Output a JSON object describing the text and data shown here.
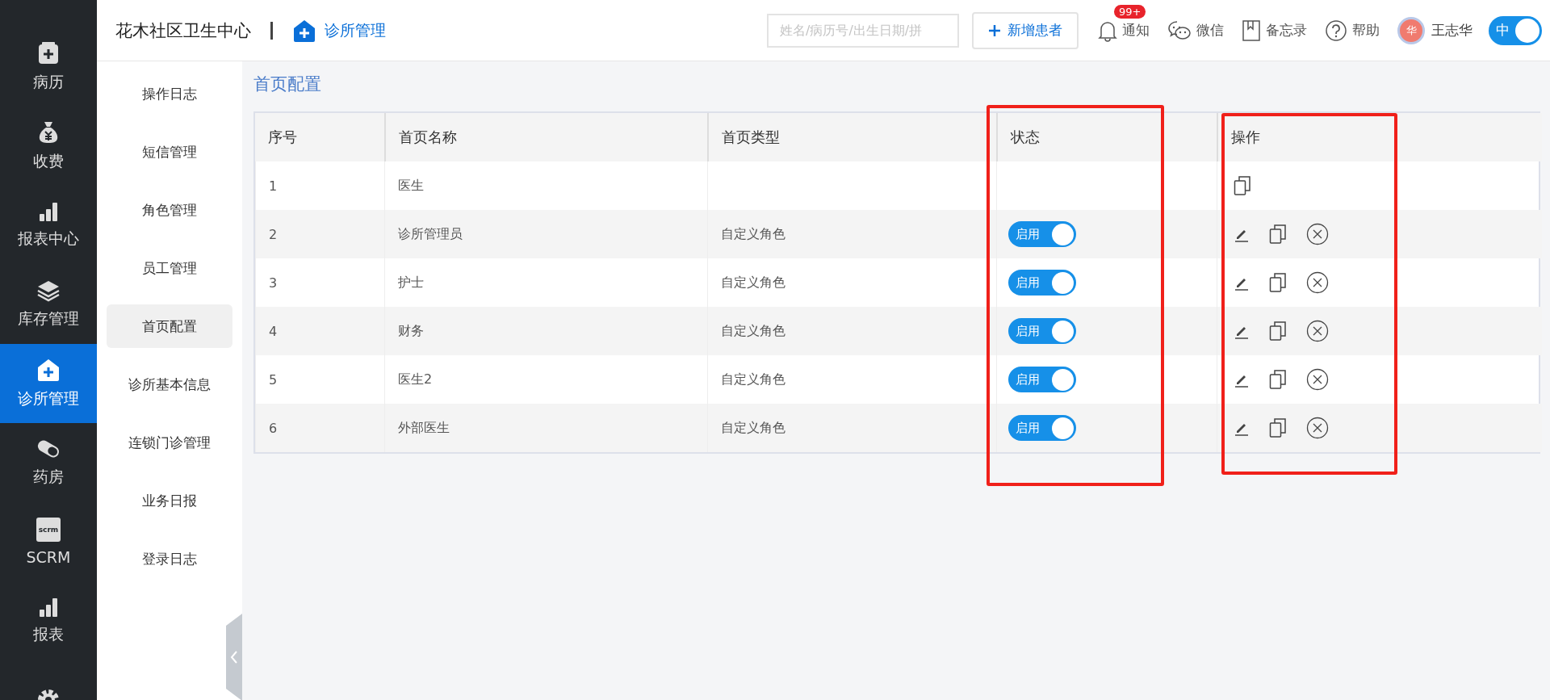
{
  "nav": {
    "items": [
      {
        "kind": "record",
        "label": "病历",
        "selected": false
      },
      {
        "kind": "money-bag",
        "label": "收费",
        "selected": false
      },
      {
        "kind": "bars",
        "label": "报表中心",
        "selected": false
      },
      {
        "kind": "layers",
        "label": "库存管理",
        "selected": false
      },
      {
        "kind": "house-plus",
        "label": "诊所管理",
        "selected": true
      },
      {
        "kind": "pill",
        "label": "药房",
        "selected": false
      },
      {
        "kind": "tag",
        "icon_text": "scrm",
        "label": "SCRM",
        "selected": false
      },
      {
        "kind": "bars",
        "label": "报表",
        "selected": false
      },
      {
        "kind": "gear",
        "selected": false
      }
    ]
  },
  "header": {
    "clinic_name": "花木社区卫生中心",
    "module": "诊所管理",
    "search": {
      "placeholder": "姓名/病历号/出生日期/拼"
    },
    "add_button": "新增患者",
    "tools": [
      {
        "kind": "bell",
        "label": "通知",
        "badge": "99+"
      },
      {
        "kind": "chat",
        "label": "微信"
      },
      {
        "kind": "book",
        "label": "备忘录"
      },
      {
        "kind": "help",
        "label": "帮助"
      }
    ],
    "user": {
      "avatar_text": "华",
      "name": "王志华"
    },
    "lang_toggle": {
      "label": "中",
      "on": true
    }
  },
  "submenu": {
    "items": [
      {
        "label": "操作日志",
        "selected": false
      },
      {
        "label": "短信管理",
        "selected": false
      },
      {
        "label": "角色管理",
        "selected": false
      },
      {
        "label": "员工管理",
        "selected": false
      },
      {
        "label": "首页配置",
        "selected": true
      },
      {
        "label": "诊所基本信息",
        "selected": false
      },
      {
        "label": "连锁门诊管理",
        "selected": false
      },
      {
        "label": "业务日报",
        "selected": false
      },
      {
        "label": "登录日志",
        "selected": false
      }
    ]
  },
  "page_title": "首页配置",
  "table": {
    "columns": [
      {
        "label": "序号",
        "highlighted": false
      },
      {
        "label": "首页名称",
        "highlighted": false
      },
      {
        "label": "首页类型",
        "highlighted": false
      },
      {
        "label": "状态",
        "highlighted": true
      },
      {
        "label": "操作",
        "highlighted": true
      }
    ],
    "rows": [
      {
        "index": "1",
        "name": "医生",
        "actions": [
          {
            "kind": "copy"
          }
        ]
      },
      {
        "index": "2",
        "name": "诊所管理员",
        "type": "自定义角色",
        "status": {
          "label": "启用",
          "on": true
        },
        "actions": [
          {
            "kind": "edit"
          },
          {
            "kind": "copy"
          },
          {
            "kind": "delete"
          }
        ]
      },
      {
        "index": "3",
        "name": "护士",
        "type": "自定义角色",
        "status": {
          "label": "启用",
          "on": true
        },
        "actions": [
          {
            "kind": "edit"
          },
          {
            "kind": "copy"
          },
          {
            "kind": "delete"
          }
        ]
      },
      {
        "index": "4",
        "name": "财务",
        "type": "自定义角色",
        "status": {
          "label": "启用",
          "on": true
        },
        "actions": [
          {
            "kind": "edit"
          },
          {
            "kind": "copy"
          },
          {
            "kind": "delete"
          }
        ]
      },
      {
        "index": "5",
        "name": "医生2",
        "type": "自定义角色",
        "status": {
          "label": "启用",
          "on": true
        },
        "actions": [
          {
            "kind": "edit"
          },
          {
            "kind": "copy"
          },
          {
            "kind": "delete"
          }
        ]
      },
      {
        "index": "6",
        "name": "外部医生",
        "type": "自定义角色",
        "status": {
          "label": "启用",
          "on": true
        },
        "actions": [
          {
            "kind": "edit"
          },
          {
            "kind": "copy"
          },
          {
            "kind": "delete"
          }
        ]
      }
    ]
  }
}
